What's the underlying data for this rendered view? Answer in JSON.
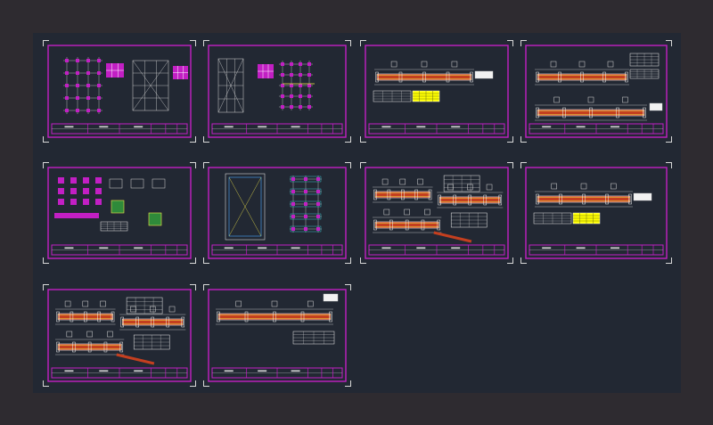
{
  "drawing": {
    "sheet_count": 10,
    "colors": {
      "frame": "#c21fc4",
      "beam_fill": "#c43f1f",
      "beam_outline": "#f2f2f2",
      "rebar": "#f2e84a",
      "grid": "#d8d8d8",
      "table_fill": "#ffff00",
      "accent_blue": "#4aa8ff",
      "accent_cyan": "#3fe0e8",
      "model_background": "#222833",
      "app_background": "#2e2b30"
    },
    "sheets": [
      {
        "id": "s1",
        "content": "column-layout-plans"
      },
      {
        "id": "s2",
        "content": "framing-plan"
      },
      {
        "id": "s3",
        "content": "beam-elevation-single"
      },
      {
        "id": "s4",
        "content": "beam-elevation-double"
      },
      {
        "id": "s5",
        "content": "footing-details"
      },
      {
        "id": "s6",
        "content": "foundation-plan"
      },
      {
        "id": "s7",
        "content": "beam-elevation-triple"
      },
      {
        "id": "s8",
        "content": "beam-elevation-single"
      },
      {
        "id": "s9",
        "content": "beam-elevation-triple"
      },
      {
        "id": "s10",
        "content": "beam-elevation-long"
      }
    ]
  }
}
